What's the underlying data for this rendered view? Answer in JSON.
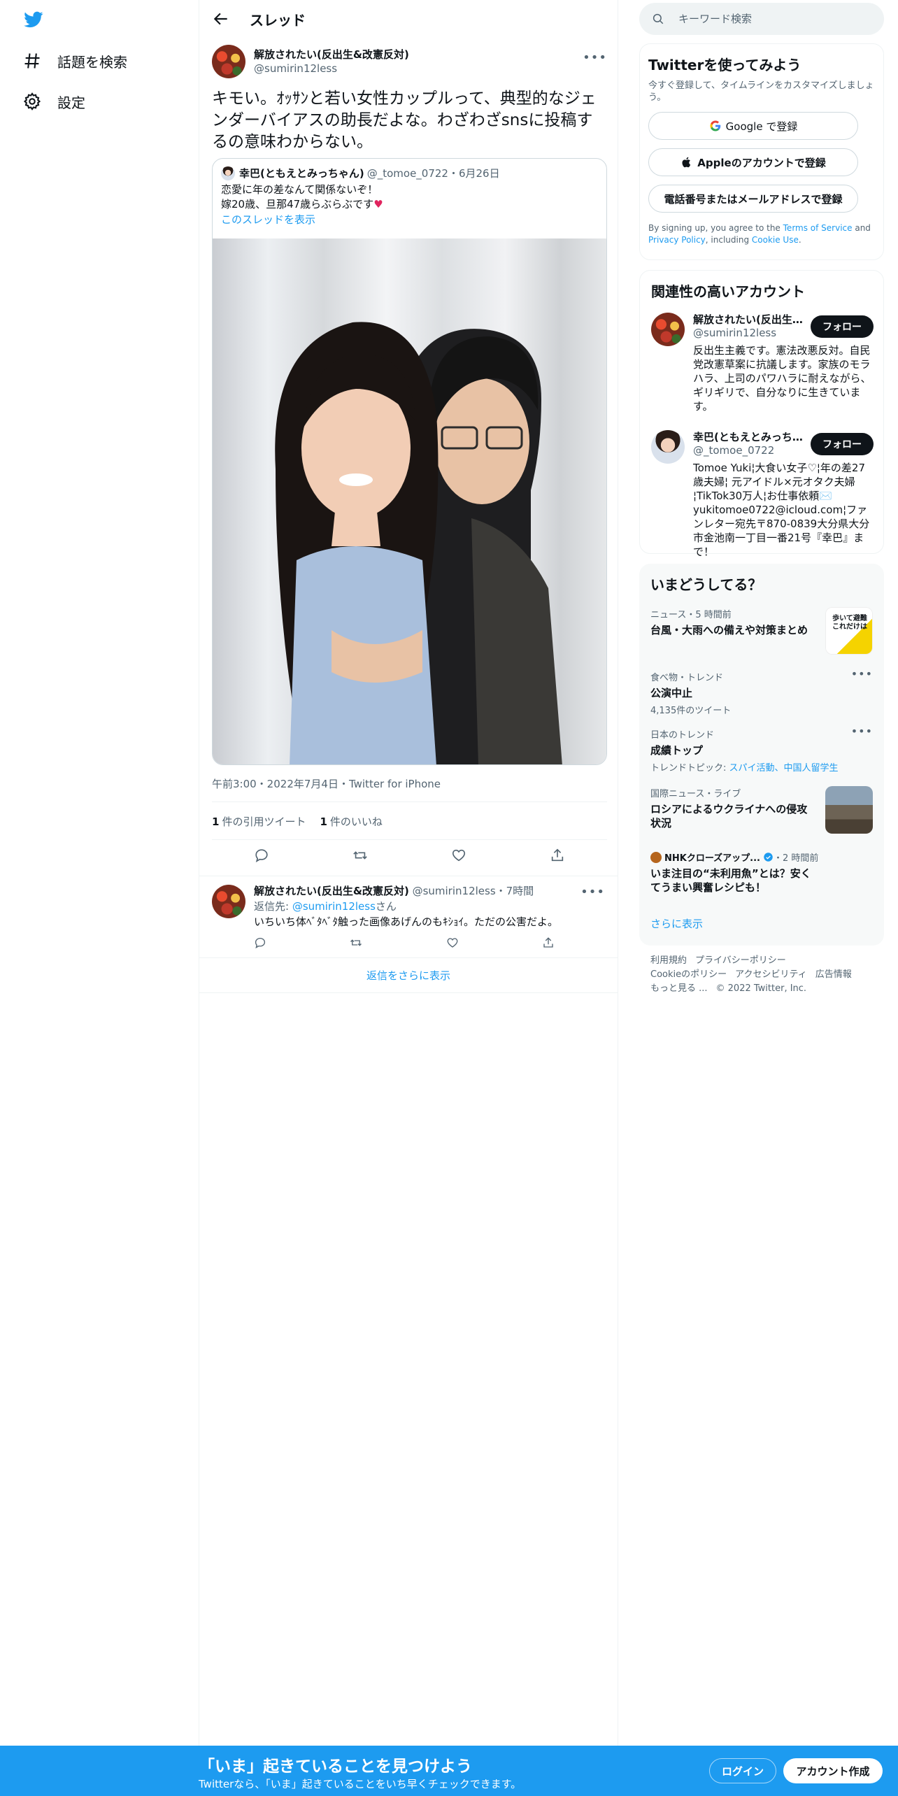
{
  "nav": {
    "items": [
      {
        "label": "話題を検索",
        "icon": "hashtag-icon"
      },
      {
        "label": "設定",
        "icon": "gear-icon"
      }
    ]
  },
  "header": {
    "title": "スレッド"
  },
  "tweet": {
    "display_name": "解放されたい(反出生&改憲反対)",
    "handle": "@sumirin12less",
    "text": "キモい。ｵｯｻﾝと若い女性カップルって、典型的なジェンダーバイアスの助長だよな。わざわざsnsに投稿するの意味わからない。",
    "timestamp": "午前3:00・2022年7月4日・Twitter for iPhone",
    "quote_count": "1",
    "quote_label": "件の引用ツイート",
    "like_count": "1",
    "like_label": "件のいいね",
    "quoted": {
      "display_name": "幸巴(ともえとみっちゃん)",
      "meta": "@_tomoe_0722・6月26日",
      "line1": "恋愛に年の差なんて関係ないぞ！",
      "line2": "嫁20歳、旦那47歳らぶらぶです",
      "heart": "♥",
      "show_thread": "このスレッドを表示"
    }
  },
  "reply": {
    "display_name": "解放されたい(反出生&改憲反対)",
    "meta": "@sumirin12less・7時間",
    "to_prefix": "返信先: ",
    "to_handle": "@sumirin12less",
    "to_suffix": "さん",
    "text": "いちいち体ﾍﾞﾀﾍﾞﾀ触った画像あげんのもｷｼｮｲ。ただの公害だよ。"
  },
  "show_more_replies": "返信をさらに表示",
  "search": {
    "placeholder": "キーワード検索"
  },
  "signup": {
    "title": "Twitterを使ってみよう",
    "desc": "今すぐ登録して、タイムラインをカスタマイズしましょう。",
    "google": "Google で登録",
    "apple": "Appleのアカウントで登録",
    "phone": "電話番号またはメールアドレスで登録",
    "legal_1": "By signing up, you agree to the ",
    "terms": "Terms of Service",
    "legal_2": " and ",
    "privacy": "Privacy Policy",
    "legal_3": ", including ",
    "cookie": "Cookie Use",
    "legal_4": "."
  },
  "related": {
    "title": "関連性の高いアカウント",
    "accounts": [
      {
        "name": "解放されたい(反出生&改憲反対)",
        "handle": "@sumirin12less",
        "follow": "フォロー",
        "bio": "反出生主義です。憲法改悪反対。自民党改憲草案に抗議します。家族のモラハラ、上司のパワハラに耐えながら、ギリギリで、自分なりに生きています。"
      },
      {
        "name": "幸巴(ともえとみっちゃん)",
        "handle": "@_tomoe_0722",
        "follow": "フォロー",
        "bio": "Tomoe Yuki¦大食い女子♡¦年の差27歳夫婦¦ 元アイドル×元オタク夫婦¦TikTok30万人¦お仕事依頼✉️yukitomoe0722@icloud.com¦ファンレター宛先〒870-0839大分県大分市金池南一丁目一番21号『幸巴』まで！"
      }
    ]
  },
  "trends": {
    "title": "いまどうしてる？",
    "items": [
      {
        "meta": "ニュース・5 時間前",
        "title": "台風・大雨への備えや対策まとめ",
        "sub": "",
        "thumb_text": "歩いて避難これだけは"
      },
      {
        "meta": "食べ物・トレンド",
        "title": "公演中止",
        "sub": "4,135件のツイート"
      },
      {
        "meta": "日本のトレンド",
        "title": "成績トップ",
        "sub_prefix": "トレンドトピック: ",
        "sub_links": "スパイ活動、中国人留学生"
      },
      {
        "meta": "国際ニュース・ライブ",
        "title": "ロシアによるウクライナへの侵攻状況"
      },
      {
        "meta_name": "NHKクローズアップ...",
        "meta_time": "・2 時間前",
        "title": "いま注目の“未利用魚”とは？安くてうまい興奮レシピも！"
      }
    ],
    "more": "さらに表示"
  },
  "footer": {
    "links": [
      "利用規約",
      "プライバシーポリシー",
      "Cookieのポリシー",
      "アクセシビリティ",
      "広告情報",
      "もっと見る ..."
    ],
    "copyright": "© 2022 Twitter, Inc."
  },
  "banner": {
    "title": "「いま」起きていることを見つけよう",
    "subtitle": "Twitterなら、「いま」起きていることをいち早くチェックできます。",
    "login": "ログイン",
    "signup": "アカウント作成"
  },
  "colors": {
    "accent": "#1d9bf0",
    "text": "#0f1419",
    "muted": "#536471"
  }
}
